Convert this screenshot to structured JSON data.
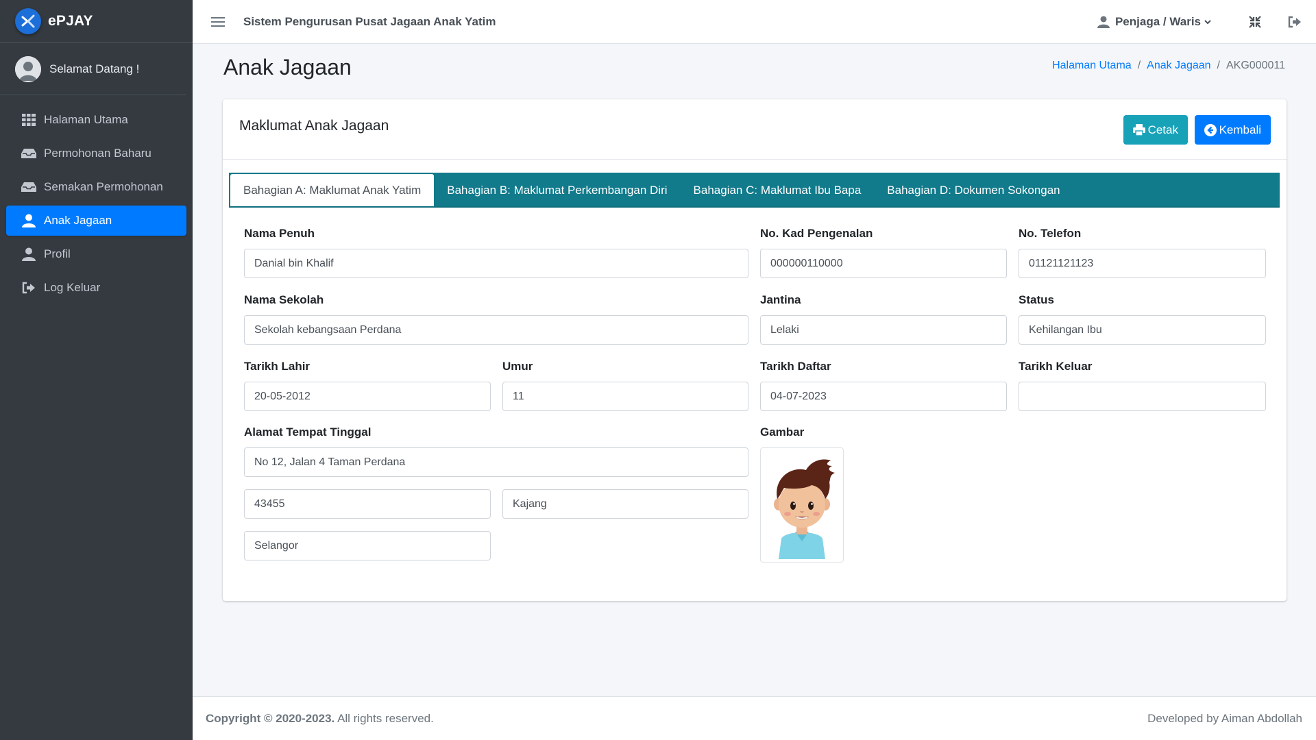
{
  "brand": {
    "name": "ePJAY"
  },
  "sidebar": {
    "welcome": "Selamat Datang !",
    "items": [
      {
        "label": "Halaman Utama",
        "icon": "grid-icon"
      },
      {
        "label": "Permohonan Baharu",
        "icon": "inbox-icon"
      },
      {
        "label": "Semakan Permohonan",
        "icon": "inbox-icon"
      },
      {
        "label": "Anak Jagaan",
        "icon": "user-icon"
      },
      {
        "label": "Profil",
        "icon": "user-icon"
      },
      {
        "label": "Log Keluar",
        "icon": "sign-out-icon"
      }
    ],
    "active_index": 3
  },
  "header": {
    "title": "Sistem Pengurusan Pusat Jagaan Anak Yatim",
    "user_menu": "Penjaga / Waris"
  },
  "page": {
    "title": "Anak Jagaan",
    "breadcrumb": [
      "Halaman Utama",
      "Anak Jagaan",
      "AKG000011"
    ]
  },
  "card": {
    "title": "Maklumat Anak Jagaan",
    "print_label": "Cetak",
    "back_label": "Kembali",
    "tabs": [
      "Bahagian A: Maklumat Anak Yatim",
      "Bahagian B: Maklumat Perkembangan Diri",
      "Bahagian C: Maklumat Ibu Bapa",
      "Bahagian D: Dokumen Sokongan"
    ]
  },
  "form": {
    "nama_penuh": {
      "label": "Nama Penuh",
      "value": "Danial bin Khalif"
    },
    "no_kp": {
      "label": "No. Kad Pengenalan",
      "value": "000000110000"
    },
    "no_tel": {
      "label": "No. Telefon",
      "value": "01121121123"
    },
    "nama_sekolah": {
      "label": "Nama Sekolah",
      "value": "Sekolah kebangsaan Perdana"
    },
    "jantina": {
      "label": "Jantina",
      "value": "Lelaki"
    },
    "status": {
      "label": "Status",
      "value": "Kehilangan Ibu"
    },
    "tarikh_lahir": {
      "label": "Tarikh Lahir",
      "value": "20-05-2012"
    },
    "umur": {
      "label": "Umur",
      "value": "11"
    },
    "tarikh_daftar": {
      "label": "Tarikh Daftar",
      "value": "04-07-2023"
    },
    "tarikh_keluar": {
      "label": "Tarikh Keluar",
      "value": ""
    },
    "alamat": {
      "label": "Alamat Tempat Tinggal",
      "line1": "No 12, Jalan 4 Taman Perdana",
      "poskod": "43455",
      "bandar": "Kajang",
      "negeri": "Selangor"
    },
    "gambar": {
      "label": "Gambar"
    }
  },
  "footer": {
    "copyright_bold": "Copyright © 2020-2023.",
    "copyright_rest": "All rights reserved.",
    "developer": "Developed by Aiman Abdollah"
  }
}
